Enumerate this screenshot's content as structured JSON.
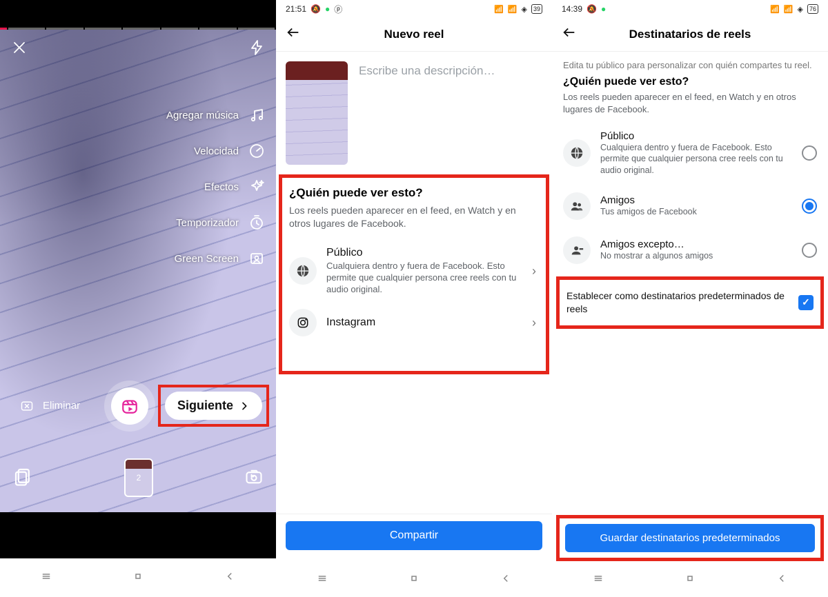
{
  "screen1": {
    "tools": {
      "add_music": "Agregar música",
      "speed": "Velocidad",
      "effects": "Efectos",
      "timer": "Temporizador",
      "green_screen": "Green Screen"
    },
    "delete_label": "Eliminar",
    "next_label": "Siguiente",
    "thumb_count": "2"
  },
  "screen2": {
    "status_time": "21:51",
    "status_battery": "39",
    "header_title": "Nuevo reel",
    "description_placeholder": "Escribe una descripción…",
    "visibility": {
      "question": "¿Quién puede ver esto?",
      "subtext": "Los reels pueden aparecer en el feed, en Watch y en otros lugares de Facebook.",
      "public_title": "Público",
      "public_desc": "Cualquiera dentro y fuera de Facebook. Esto permite que cualquier persona cree reels con tu audio original.",
      "instagram_title": "Instagram"
    },
    "share_button": "Compartir"
  },
  "screen3": {
    "status_time": "14:39",
    "status_battery": "76",
    "header_title": "Destinatarios de reels",
    "intro": "Edita tu público para personalizar con quién compartes tu reel.",
    "question": "¿Quién puede ver esto?",
    "subtext": "Los reels pueden aparecer en el feed, en Watch y en otros lugares de Facebook.",
    "audience": {
      "public_title": "Público",
      "public_desc": "Cualquiera dentro y fuera de Facebook. Esto permite que cualquier persona cree reels con tu audio original.",
      "friends_title": "Amigos",
      "friends_desc": "Tus amigos de Facebook",
      "friends_except_title": "Amigos excepto…",
      "friends_except_desc": "No mostrar a algunos amigos"
    },
    "default_checkbox_label": "Establecer como destinatarios predeterminados de reels",
    "save_button": "Guardar destinatarios predeterminados"
  }
}
